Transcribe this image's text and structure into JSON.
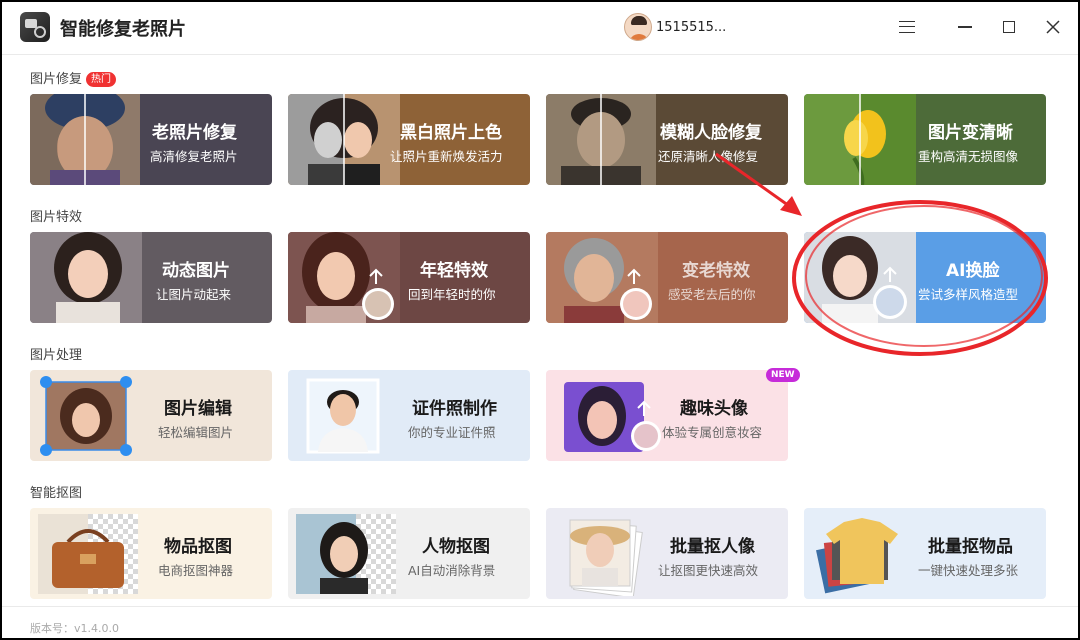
{
  "app": {
    "title": "智能修复老照片"
  },
  "user": {
    "name": "1515515..."
  },
  "sections": {
    "repair": "图片修复",
    "hot": "热门",
    "effects": "图片特效",
    "processing": "图片处理",
    "cutout": "智能抠图"
  },
  "cards": {
    "old_photo_repair": {
      "title": "老照片修复",
      "sub": "高清修复老照片"
    },
    "bw_colorize": {
      "title": "黑白照片上色",
      "sub": "让照片重新焕发活力"
    },
    "blur_face_repair": {
      "title": "模糊人脸修复",
      "sub": "还原清晰人像修复"
    },
    "photo_enhance": {
      "title": "图片变清晰",
      "sub": "重构高清无损图像"
    },
    "animated_photo": {
      "title": "动态图片",
      "sub": "让图片动起来"
    },
    "younger_effect": {
      "title": "年轻特效",
      "sub": "回到年轻时的你"
    },
    "older_effect": {
      "title": "变老特效",
      "sub": "感受老去后的你"
    },
    "ai_face_swap": {
      "title": "AI换脸",
      "sub": "尝试多样风格造型"
    },
    "photo_edit": {
      "title": "图片编辑",
      "sub": "轻松编辑图片"
    },
    "id_photo": {
      "title": "证件照制作",
      "sub": "你的专业证件照"
    },
    "fun_avatar": {
      "title": "趣味头像",
      "sub": "体验专属创意妆容",
      "badge": "NEW"
    },
    "object_cutout": {
      "title": "物品抠图",
      "sub": "电商抠图神器"
    },
    "person_cutout": {
      "title": "人物抠图",
      "sub": "AI自动消除背景"
    },
    "batch_portrait": {
      "title": "批量抠人像",
      "sub": "让抠图更快速高效"
    },
    "batch_object": {
      "title": "批量抠物品",
      "sub": "一键快速处理多张"
    }
  },
  "footer": {
    "version": "版本号：v1.4.0.0"
  },
  "colors": {
    "old_photo_bg": "#4a4553",
    "bw_bg": "#8e6237",
    "blur_bg": "#5b4a36",
    "enhance_bg": "#4d6b39",
    "animated_bg": "#625b61",
    "younger_bg": "#6d4744",
    "older_bg": "#a6654c",
    "faceswap_bg": "#5a9ee6",
    "edit_bg": "#f1e6da",
    "id_bg": "#e1ebf7",
    "fun_bg": "#fbe1e6",
    "object_bg": "#faf2e4",
    "person_bg": "#f0f0f0",
    "batch_portrait_bg": "#ebebf3",
    "batch_object_bg": "#e5eef9",
    "annotation": "#e8262a"
  },
  "icons": [
    "app-icon",
    "menu-icon",
    "minimize-icon",
    "maximize-icon",
    "close-icon",
    "avatar"
  ]
}
